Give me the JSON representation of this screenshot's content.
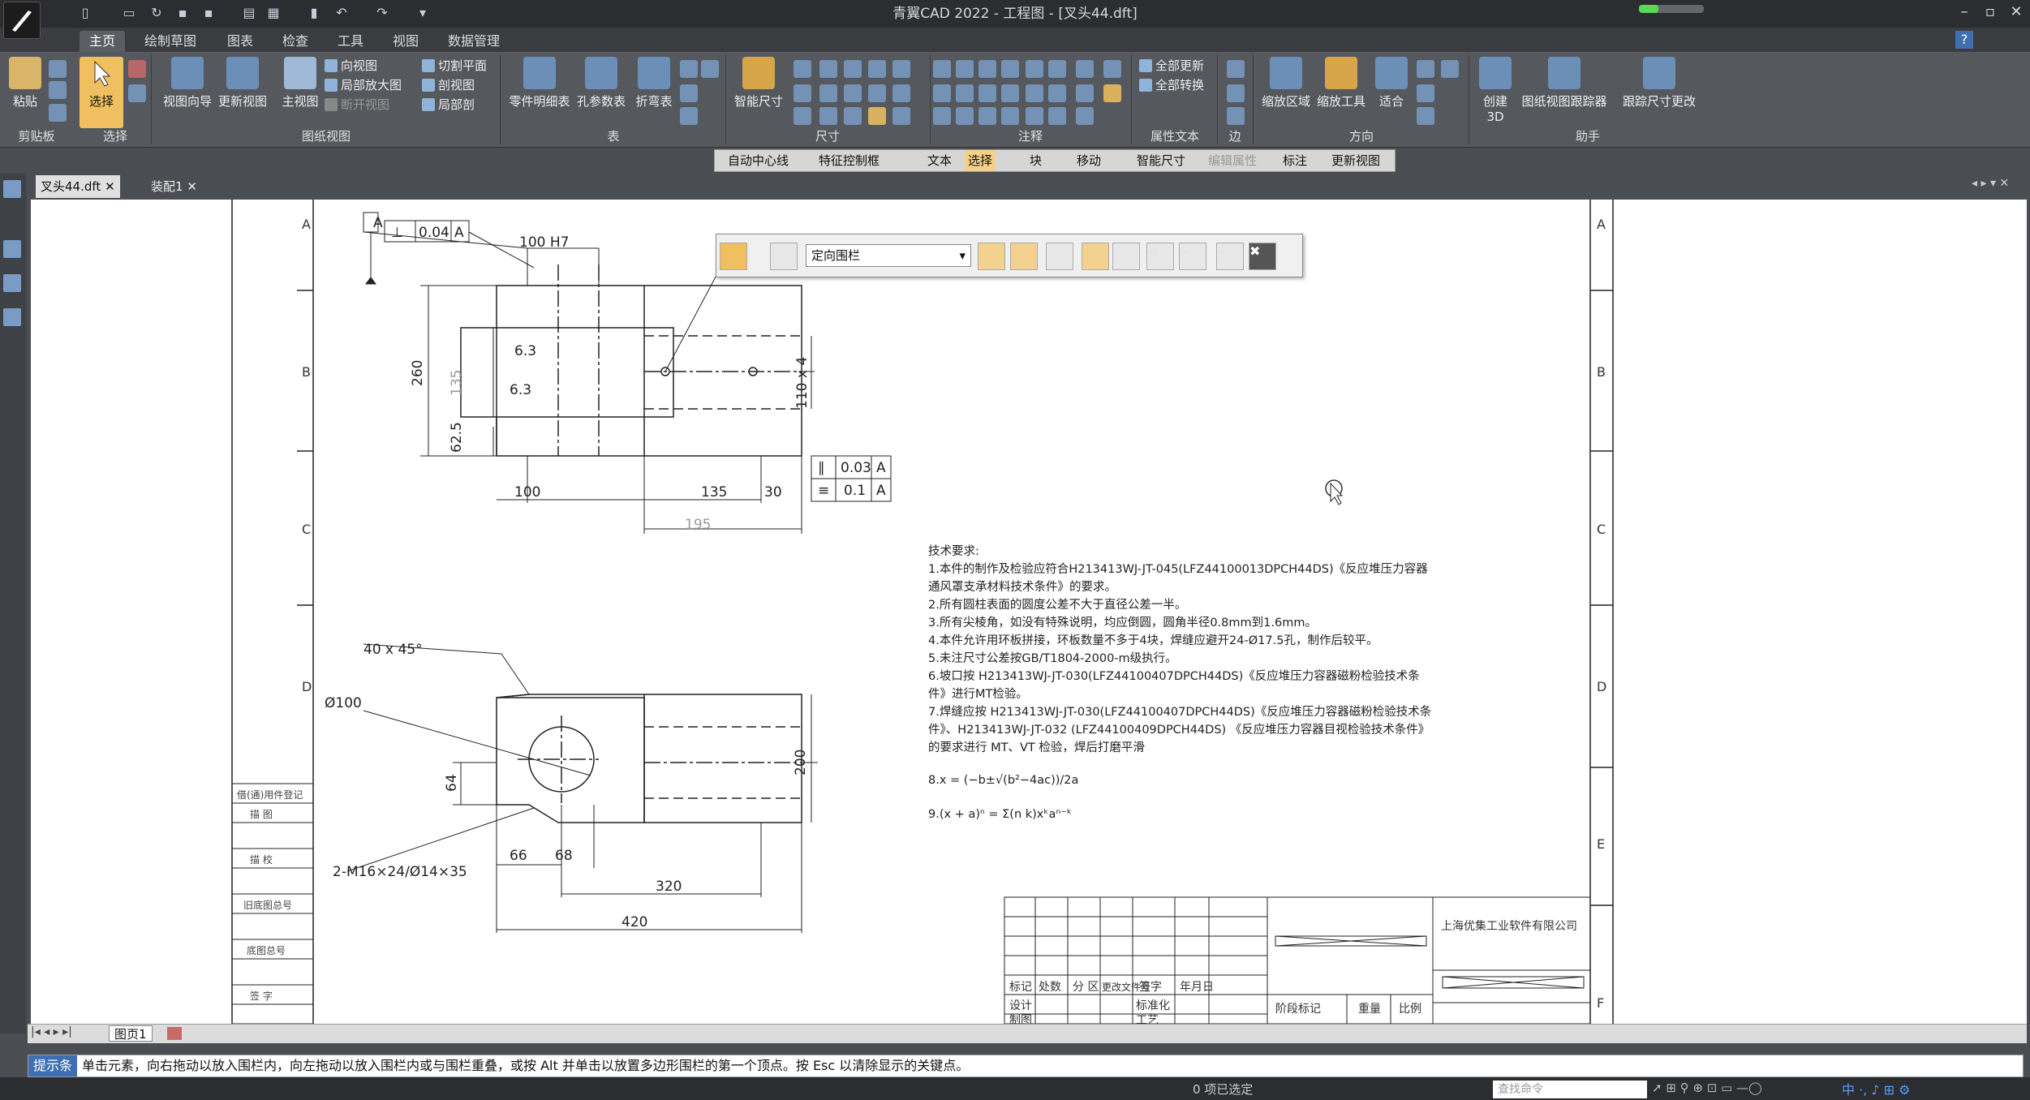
{
  "window": {
    "title": "青翼CAD 2022 - 工程图 - [叉头44.dft]"
  },
  "menu": {
    "tabs": [
      "主页",
      "绘制草图",
      "图表",
      "检查",
      "工具",
      "视图",
      "数据管理"
    ]
  },
  "ribbon": {
    "groups": [
      "剪贴板",
      "选择",
      "图纸视图",
      "表",
      "尺寸",
      "注释",
      "属性文本",
      "边",
      "方向",
      "助手"
    ],
    "paste": "粘贴",
    "select": "选择",
    "view_wizard": "视图向导",
    "update_view": "更新视图",
    "principal_view": "主视图",
    "dir_view": "向视图",
    "detail_view": "局部放大图",
    "break_view": "断开视图",
    "section_plane": "切割平面",
    "section_view": "剖视图",
    "partial_section": "局部剖",
    "parts_list": "零件明细表",
    "hole_table": "孔参数表",
    "bend_table": "折弯表",
    "smart_dim": "智能尺寸",
    "update_all": "全部更新",
    "convert_all": "全部转换",
    "zoom_area": "缩放区域",
    "zoom_tool": "缩放工具",
    "fit": "适合",
    "create_3d": "创建3D",
    "sheet_tracker": "图纸视图跟踪器",
    "track_dim": "跟踪尺寸更改"
  },
  "command_bar": [
    "自动中心线",
    "特征控制框",
    "文本",
    "选择",
    "块",
    "移动",
    "智能尺寸",
    "编辑属性",
    "标注",
    "更新视图"
  ],
  "doc_tabs": [
    {
      "label": "叉头44.dft"
    },
    {
      "label": "装配1"
    }
  ],
  "floating_toolbar": {
    "fence_option": "定向围栏"
  },
  "drawing": {
    "border_rows": [
      "A",
      "B",
      "C",
      "D",
      "E",
      "F"
    ],
    "dims": {
      "tol_box1": "0.04",
      "datum": "A",
      "hole_fit": "100 H7",
      "d260": "260",
      "d135": "135",
      "d62": "62.5",
      "d110": "110 x 4",
      "r63a": "6.3",
      "r63b": "6.3",
      "d100": "100",
      "d135b": "135",
      "d30": "30",
      "d195": "195",
      "par": "0.03",
      "sym": "0.1",
      "chamfer": "40 x 45°",
      "dia100": "Ø100",
      "d64": "64",
      "d200": "200",
      "thread": "2-M16×24/Ø14×35",
      "d66": "66",
      "d68": "68",
      "d320": "320",
      "d420": "420"
    },
    "tech_req": {
      "title": "技术要求:",
      "lines": [
        "1.本件的制作及检验应符合H213413WJ-JT-045(LFZ44100013DPCH44DS)《反应堆压力容器",
        "通风罩支承材料技术条件》的要求。",
        "2.所有圆柱表面的圆度公差不大于直径公差一半。",
        "3.所有尖棱角，如没有特殊说明，均应倒圆，圆角半径0.8mm到1.6mm。",
        "4.本件允许用环板拼接，环板数量不多于4块，焊缝应避开24-Ø17.5孔，制作后较平。",
        "5.未注尺寸公差按GB/T1804-2000-m级执行。",
        "6.坡口按 H213413WJ-JT-030(LFZ44100407DPCH44DS)《反应堆压力容器磁粉检验技术条",
        "件》进行MT检验。",
        "7.焊缝应按 H213413WJ-JT-030(LFZ44100407DPCH44DS)《反应堆压力容器磁粉检验技术条",
        "件》、H213413WJ-JT-032 (LFZ44100409DPCH44DS) 《反应堆压力容器目视检验技术条件》",
        "的要求进行 MT、VT 检验，焊后打磨平滑"
      ],
      "formula8": "8.x = (−b±√(b²−4ac))/2a",
      "formula9": "9.(x + a)ⁿ = Σ(n k)xᵏaⁿ⁻ᵏ"
    },
    "title_block": {
      "company": "上海优集工业软件有限公司",
      "hdr": [
        "标记",
        "处数",
        "分 区",
        "更改文件号",
        "签字",
        "年月日"
      ],
      "row2": [
        "设计",
        "",
        "标准化"
      ],
      "row3": [
        "制图",
        "",
        "工艺"
      ],
      "stage": "阶段标记",
      "weight": "重量",
      "scale": "比例"
    },
    "side_labels": [
      "借(通)用件登记",
      "描  图",
      "描  校",
      "旧底图总号",
      "底图总号",
      "签  字"
    ]
  },
  "sheet_tab": "图页1",
  "hint": {
    "label": "提示条",
    "text": "单击元素，向右拖动以放入围栏内，向左拖动以放入围栏内或与围栏重叠，或按 Alt 并单击以放置多边形围栏的第一个顶点。按 Esc 以清除显示的关键点。"
  },
  "status": {
    "selected": "0 项已选定",
    "search_placeholder": "查找命令"
  }
}
